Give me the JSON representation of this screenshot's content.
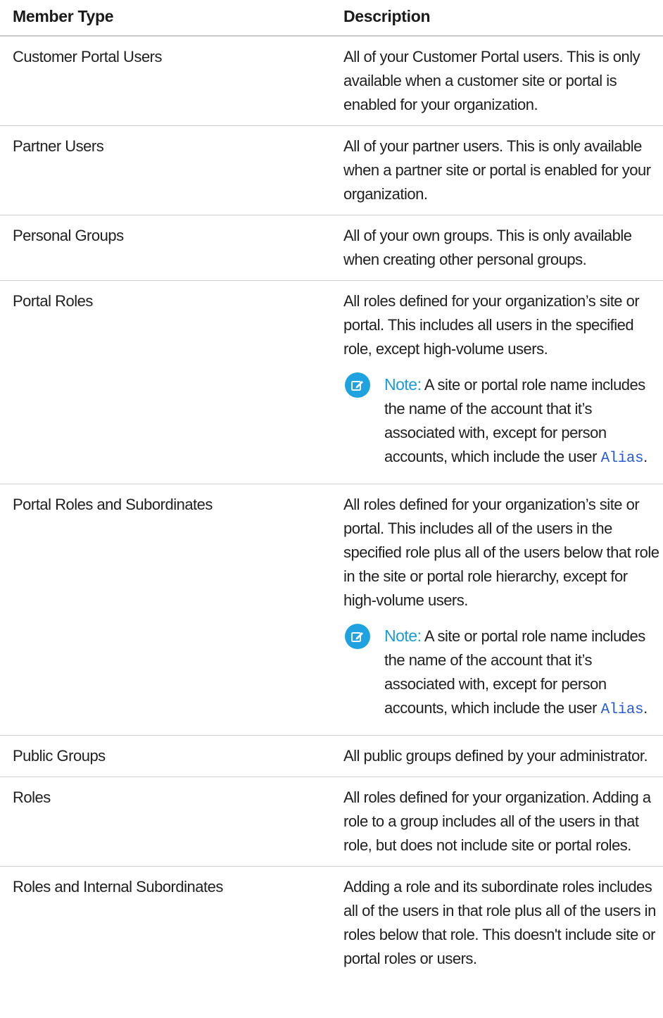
{
  "table": {
    "headers": {
      "member_type": "Member Type",
      "description": "Description"
    },
    "rows": [
      {
        "type": "Customer Portal Users",
        "description": "All of your Customer Portal users. This is only available when a customer site or portal is enabled for your organization."
      },
      {
        "type": "Partner Users",
        "description": "All of your partner users. This is only available when a partner site or portal is enabled for your organization."
      },
      {
        "type": "Personal Groups",
        "description": "All of your own groups. This is only available when creating other personal groups."
      },
      {
        "type": "Portal Roles",
        "description": "All roles defined for your organization’s site or portal. This includes all users in the specified role, except high-volume users.",
        "note": {
          "label": "Note:",
          "text": " A site or portal role name includes the name of the account that it’s associated with, except for person accounts, which include the user ",
          "link": "Alias",
          "end": "."
        }
      },
      {
        "type": "Portal Roles and Subordinates",
        "description": "All roles defined for your organization’s site or portal. This includes all of the users in the specified role plus all of the users below that role in the site or portal role hierarchy, except for high-volume users.",
        "note": {
          "label": "Note:",
          "text": " A site or portal role name includes the name of the account that it’s associated with, except for person accounts, which include the user ",
          "link": "Alias",
          "end": "."
        }
      },
      {
        "type": "Public Groups",
        "description": "All public groups defined by your administrator."
      },
      {
        "type": "Roles",
        "description": "All roles defined for your organization. Adding a role to a group includes all of the users in that role, but does not include site or portal roles."
      },
      {
        "type": "Roles and Internal Subordinates",
        "description": "Adding a role and its subordinate roles includes all of the users in that role plus all of the users in roles below that role. This doesn't include site or portal roles or users."
      }
    ]
  },
  "icons": {
    "note": "edit-note-icon"
  },
  "colors": {
    "note_accent": "#1a9bd7",
    "note_icon_bg": "#1ea3e0",
    "link": "#2a5bd7",
    "row_border": "#cfcfcf"
  }
}
